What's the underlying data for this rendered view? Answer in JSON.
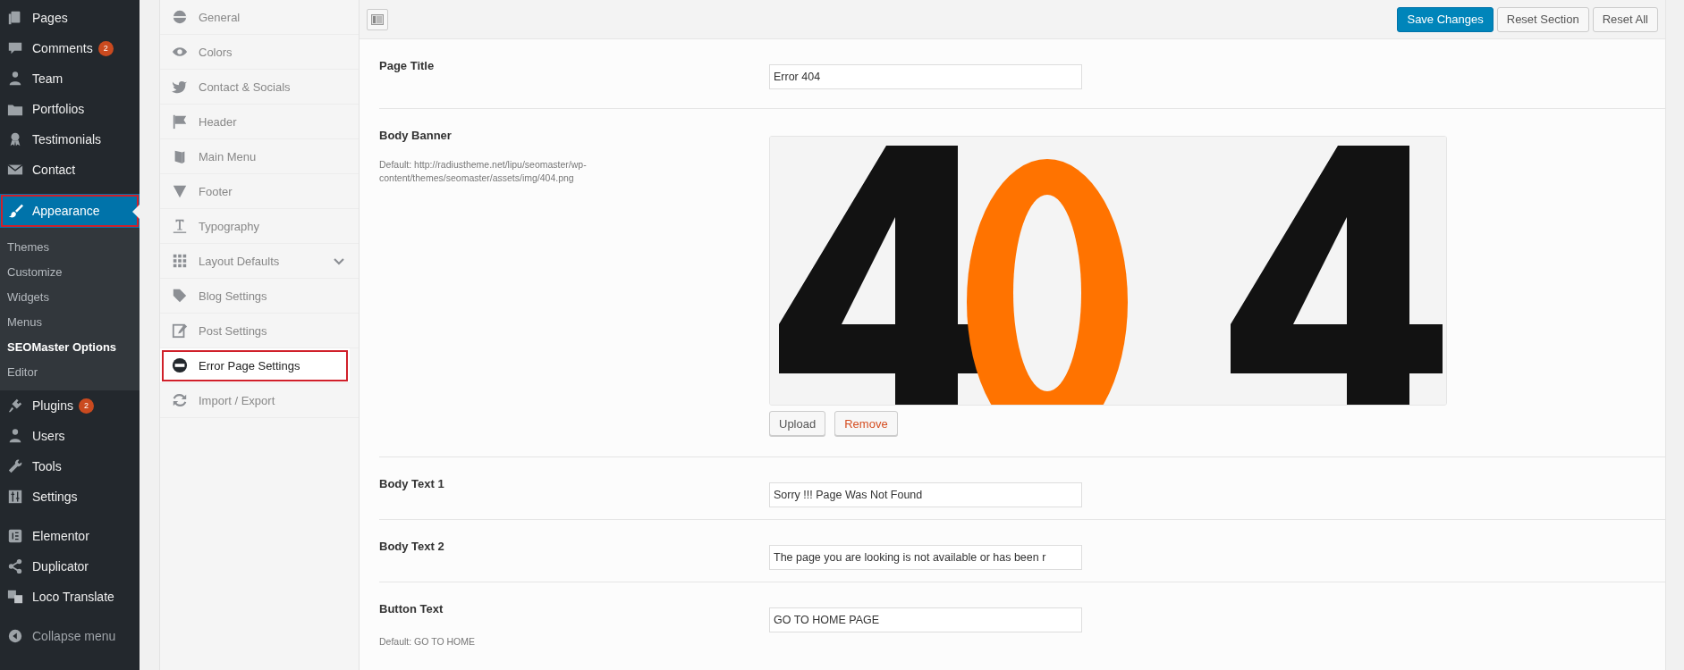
{
  "admin_menu": {
    "groups": [
      [
        {
          "label": "Pages",
          "selected": false,
          "annotated": false
        },
        {
          "label": "Comments",
          "badge": "2",
          "selected": false,
          "annotated": false
        },
        {
          "label": "Team",
          "selected": false,
          "annotated": false
        },
        {
          "label": "Portfolios",
          "selected": false,
          "annotated": false
        },
        {
          "label": "Testimonials",
          "selected": false,
          "annotated": false
        },
        {
          "label": "Contact",
          "selected": false,
          "annotated": false
        }
      ],
      [
        {
          "label": "Appearance",
          "selected": true,
          "annotated": true,
          "submenu": [
            {
              "label": "Themes",
              "selected": false
            },
            {
              "label": "Customize",
              "selected": false
            },
            {
              "label": "Widgets",
              "selected": false
            },
            {
              "label": "Menus",
              "selected": false
            },
            {
              "label": "SEOMaster Options",
              "selected": true
            },
            {
              "label": "Editor",
              "selected": false
            }
          ]
        },
        {
          "label": "Plugins",
          "badge": "2",
          "selected": false,
          "annotated": false
        },
        {
          "label": "Users",
          "selected": false,
          "annotated": false
        },
        {
          "label": "Tools",
          "selected": false,
          "annotated": false
        },
        {
          "label": "Settings",
          "selected": false,
          "annotated": false
        }
      ],
      [
        {
          "label": "Elementor",
          "selected": false,
          "annotated": false
        },
        {
          "label": "Duplicator",
          "selected": false,
          "annotated": false
        },
        {
          "label": "Loco Translate",
          "selected": false,
          "annotated": false
        }
      ]
    ],
    "collapse": "Collapse menu"
  },
  "options_menu": [
    {
      "label": "General",
      "selected": false,
      "annotated": false,
      "expandable": false
    },
    {
      "label": "Colors",
      "selected": false,
      "annotated": false,
      "expandable": false
    },
    {
      "label": "Contact & Socials",
      "selected": false,
      "annotated": false,
      "expandable": false
    },
    {
      "label": "Header",
      "selected": false,
      "annotated": false,
      "expandable": false
    },
    {
      "label": "Main Menu",
      "selected": false,
      "annotated": false,
      "expandable": false
    },
    {
      "label": "Footer",
      "selected": false,
      "annotated": false,
      "expandable": false
    },
    {
      "label": "Typography",
      "selected": false,
      "annotated": false,
      "expandable": false
    },
    {
      "label": "Layout Defaults",
      "selected": false,
      "annotated": false,
      "expandable": true
    },
    {
      "label": "Blog Settings",
      "selected": false,
      "annotated": false,
      "expandable": false
    },
    {
      "label": "Post Settings",
      "selected": false,
      "annotated": false,
      "expandable": false
    },
    {
      "label": "Error Page Settings",
      "selected": true,
      "annotated": true,
      "expandable": false
    },
    {
      "label": "Import / Export",
      "selected": false,
      "annotated": false,
      "expandable": false
    }
  ],
  "toolbar_buttons": [
    {
      "label": "Save Changes",
      "kind": "primary"
    },
    {
      "label": "Reset Section",
      "kind": "secondary"
    },
    {
      "label": "Reset All",
      "kind": "secondary"
    }
  ],
  "fields": [
    {
      "kind": "text",
      "label": "Page Title",
      "value": "Error 404"
    },
    {
      "label": "Body Banner",
      "default": "Default: http://radiustheme.net/lipu/seomaster/wp-content/themes/seomaster/assets/img/404.png",
      "buttons": [
        {
          "label": "Upload",
          "kind": "normal"
        },
        {
          "label": "Remove",
          "kind": "danger"
        }
      ]
    },
    {
      "kind": "text",
      "label": "Body Text 1",
      "value": "Sorry !!! Page Was Not Found"
    },
    {
      "kind": "text",
      "label": "Body Text 2",
      "value": "The page you are looking is not available or has been r"
    },
    {
      "kind": "text",
      "label": "Button Text",
      "value": "GO TO HOME PAGE",
      "default": "Default: GO TO HOME"
    }
  ]
}
